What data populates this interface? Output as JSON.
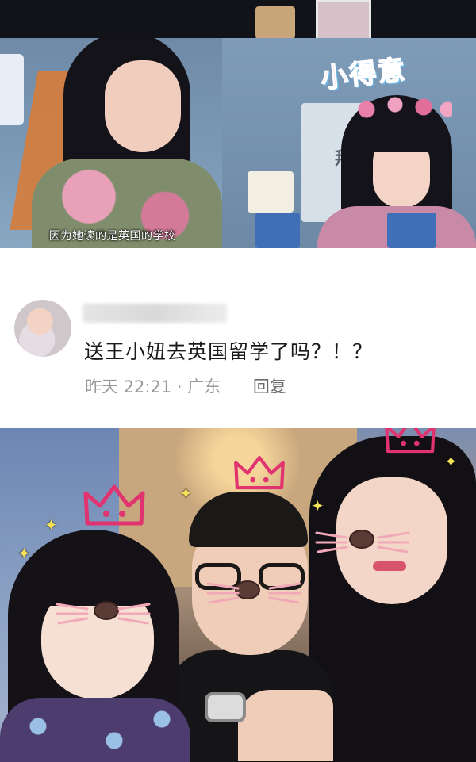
{
  "video_still": {
    "caption": "因为她读的是英国的学校",
    "sticker": "小得意",
    "side_text": "拜"
  },
  "comment": {
    "text": "送王小妞去英国留学了吗？！？",
    "timestamp": "昨天 22:21 · 广东",
    "reply_label": "回复"
  },
  "selfie": {
    "sticker_colors": {
      "crown": "#e0336f",
      "nose": "#5a3b36",
      "sparkle": "#f6e25a"
    }
  }
}
